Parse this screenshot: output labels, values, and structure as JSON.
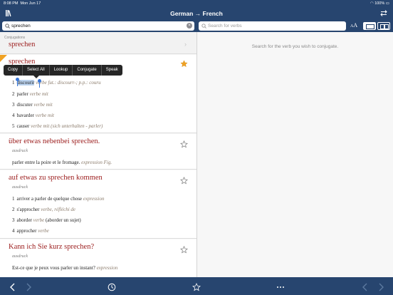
{
  "statusbar": {
    "time": "8:08 PM",
    "date": "Mon Jun 17",
    "battery": "100%"
  },
  "nav": {
    "title": "German → French"
  },
  "search": {
    "left_value": "sprechen",
    "right_placeholder": "Search for verbs",
    "aa_label_small": "A",
    "aa_label_big": "A"
  },
  "left": {
    "conj_label": "Conjugations",
    "conj_verb": "sprechen",
    "context_menu": [
      "Copy",
      "Select All",
      "Lookup",
      "Conjugate",
      "Speak"
    ],
    "entries": [
      {
        "headword": "sprechen",
        "senses": [
          {
            "n": "1",
            "word": "discourir",
            "pos": "verbe",
            "extra": "fut.: discourr-; p.p.: couru"
          },
          {
            "n": "2",
            "word": "parler",
            "pos": "verbe",
            "extra": "mit"
          },
          {
            "n": "3",
            "word": "discuter",
            "pos": "verbe",
            "extra": "mit"
          },
          {
            "n": "4",
            "word": "bavarder",
            "pos": "verbe",
            "extra": "mit"
          },
          {
            "n": "5",
            "word": "causer",
            "pos": "verbe",
            "extra": "mit (sich unterhalten - parler)"
          }
        ]
      },
      {
        "headword": "über etwas nebenbei sprechen.",
        "pos": "ausdruck",
        "translation": "parler entre la poire et le fromage.",
        "translation_tag": "expression Fig."
      },
      {
        "headword": "auf etwas zu sprechen kommen",
        "pos": "ausdruck",
        "senses": [
          {
            "n": "1",
            "word": "arriver a parler de quelque chose",
            "pos": "expression",
            "extra": ""
          },
          {
            "n": "2",
            "word": "s'approcher",
            "pos": "verbe, réfléchi",
            "extra": "de"
          },
          {
            "n": "3",
            "word": "aborder",
            "pos": "verbe",
            "extra": "(aborder un sujet)"
          },
          {
            "n": "4",
            "word": "approcher",
            "pos": "verbe",
            "extra": ""
          }
        ]
      },
      {
        "headword": "Kann ich Sie kurz sprechen?",
        "pos": "ausdruck",
        "translation": "Est-ce que je peux vous parler un instant?",
        "translation_tag": "expression"
      }
    ]
  },
  "right": {
    "message": "Search for the verb you wish to conjugate."
  },
  "toolbar": {
    "icons": [
      "back-icon",
      "forward-icon",
      "history-icon",
      "favorites-icon",
      "more-icon",
      "prev-icon",
      "next-icon"
    ]
  },
  "colors": {
    "bar": "#27456f",
    "headword": "#9b1c1c",
    "star_filled": "#f0a224"
  }
}
